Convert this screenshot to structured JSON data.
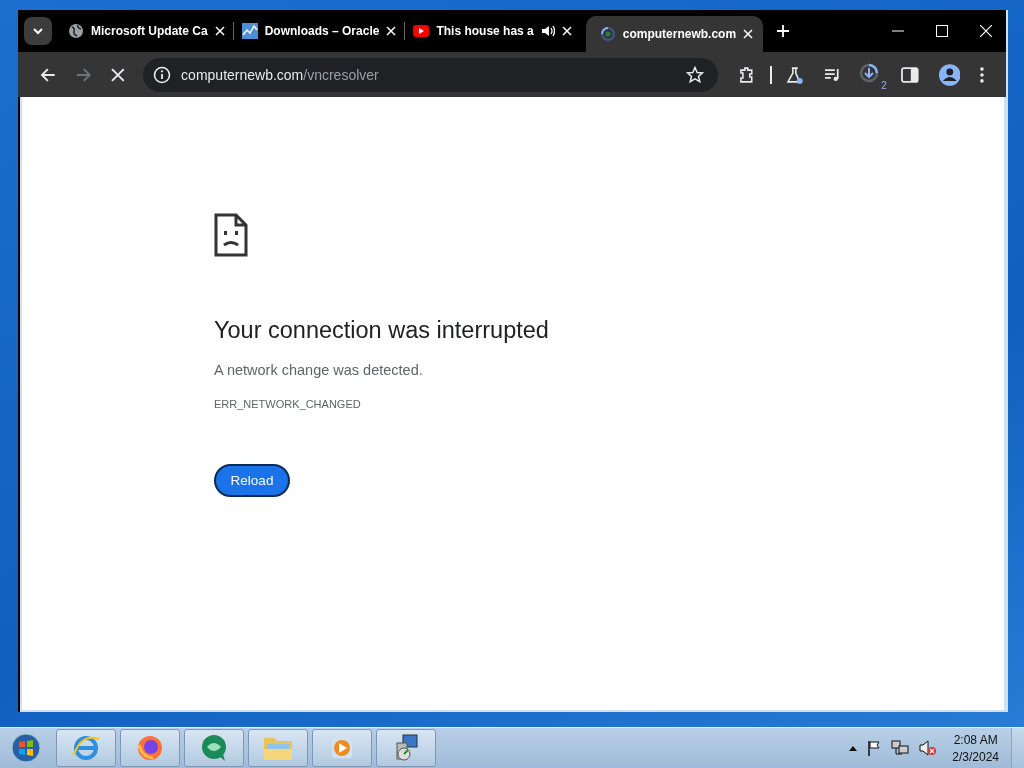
{
  "browser": {
    "tabs": [
      {
        "title": "Microsoft Update Ca",
        "selected": false,
        "audio": false
      },
      {
        "title": "Downloads – Oracle",
        "selected": false,
        "audio": false
      },
      {
        "title": "This house has a",
        "selected": false,
        "audio": true
      },
      {
        "title": "computernewb.com",
        "selected": true,
        "audio": false
      }
    ],
    "address": {
      "domain": "computernewb.com",
      "path": "/vncresolver"
    },
    "loading": true,
    "downloads_badge": "2"
  },
  "page": {
    "heading": "Your connection was interrupted",
    "message": "A network change was detected.",
    "error_code": "ERR_NETWORK_CHANGED",
    "button": "Reload"
  },
  "taskbar": {
    "apps": [
      {
        "kind": "ie"
      },
      {
        "kind": "firefox"
      },
      {
        "kind": "green"
      },
      {
        "kind": "folder"
      },
      {
        "kind": "media"
      },
      {
        "kind": "setup"
      }
    ],
    "time": "2:08 AM",
    "date": "2/3/2024"
  }
}
